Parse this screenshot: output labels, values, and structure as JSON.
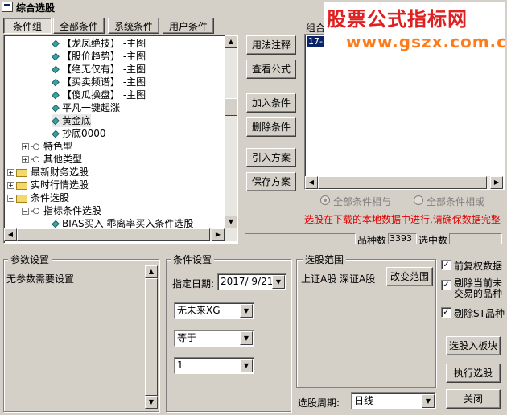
{
  "window": {
    "title": "综合选股"
  },
  "tabs": [
    {
      "label": "条件组"
    },
    {
      "label": "全部条件"
    },
    {
      "label": "系统条件"
    },
    {
      "label": "用户条件"
    }
  ],
  "tree": {
    "items": [
      {
        "label": "【龙凤绝技】 -主图"
      },
      {
        "label": "【股价趋势】 -主图"
      },
      {
        "label": "【绝无仅有】 -主图"
      },
      {
        "label": "【买卖频谱】 -主图"
      },
      {
        "label": "【傻瓜操盘】 -主图"
      },
      {
        "label": "平凡一键起涨"
      },
      {
        "label": "黄金底"
      },
      {
        "label": "抄底0000"
      },
      {
        "label": "特色型"
      },
      {
        "label": "其他类型"
      },
      {
        "label": "最新财务选股"
      },
      {
        "label": "实时行情选股"
      },
      {
        "label": "条件选股"
      },
      {
        "label": "指标条件选股"
      },
      {
        "label": "BIAS买入  乖离率买入条件选股"
      }
    ]
  },
  "side_buttons": {
    "usage": "用法注释",
    "view_formula": "查看公式",
    "add_condition": "加入条件",
    "delete_condition": "删除条件",
    "import_plan": "引入方案",
    "save_plan": "保存方案"
  },
  "combo_group": {
    "label": "组合",
    "selected_row": "17-("
  },
  "watermark": {
    "line1": "股票公式指标网",
    "line2": "www.gszx.com.cn"
  },
  "radios": {
    "all_and": "全部条件相与",
    "all_or": "全部条件相或"
  },
  "notice": "选股在下载的本地数据中进行,请确保数据完整",
  "stats": {
    "stock_count_label": "品种数",
    "stock_count_value": "3393",
    "selected_label": "选中数",
    "selected_value": ""
  },
  "params": {
    "title": "参数设置",
    "content": "无参数需要设置"
  },
  "condition_settings": {
    "title": "条件设置",
    "date_label": "指定日期:",
    "date_value": "2017/ 9/21",
    "combo1": "无未来XG",
    "combo2": "等于",
    "combo3": "1"
  },
  "range": {
    "title": "选股范围",
    "text": "上证A股  深证A股",
    "change_button": "改变范围"
  },
  "options": {
    "pre_adjust": "前复权数据",
    "exclude_suspended": "剔除当前未交易的品种",
    "exclude_st": "剔除ST品种"
  },
  "actions": {
    "to_block": "选股入板块",
    "execute": "执行选股",
    "close": "关闭"
  },
  "period": {
    "label": "选股周期:",
    "value": "日线"
  }
}
